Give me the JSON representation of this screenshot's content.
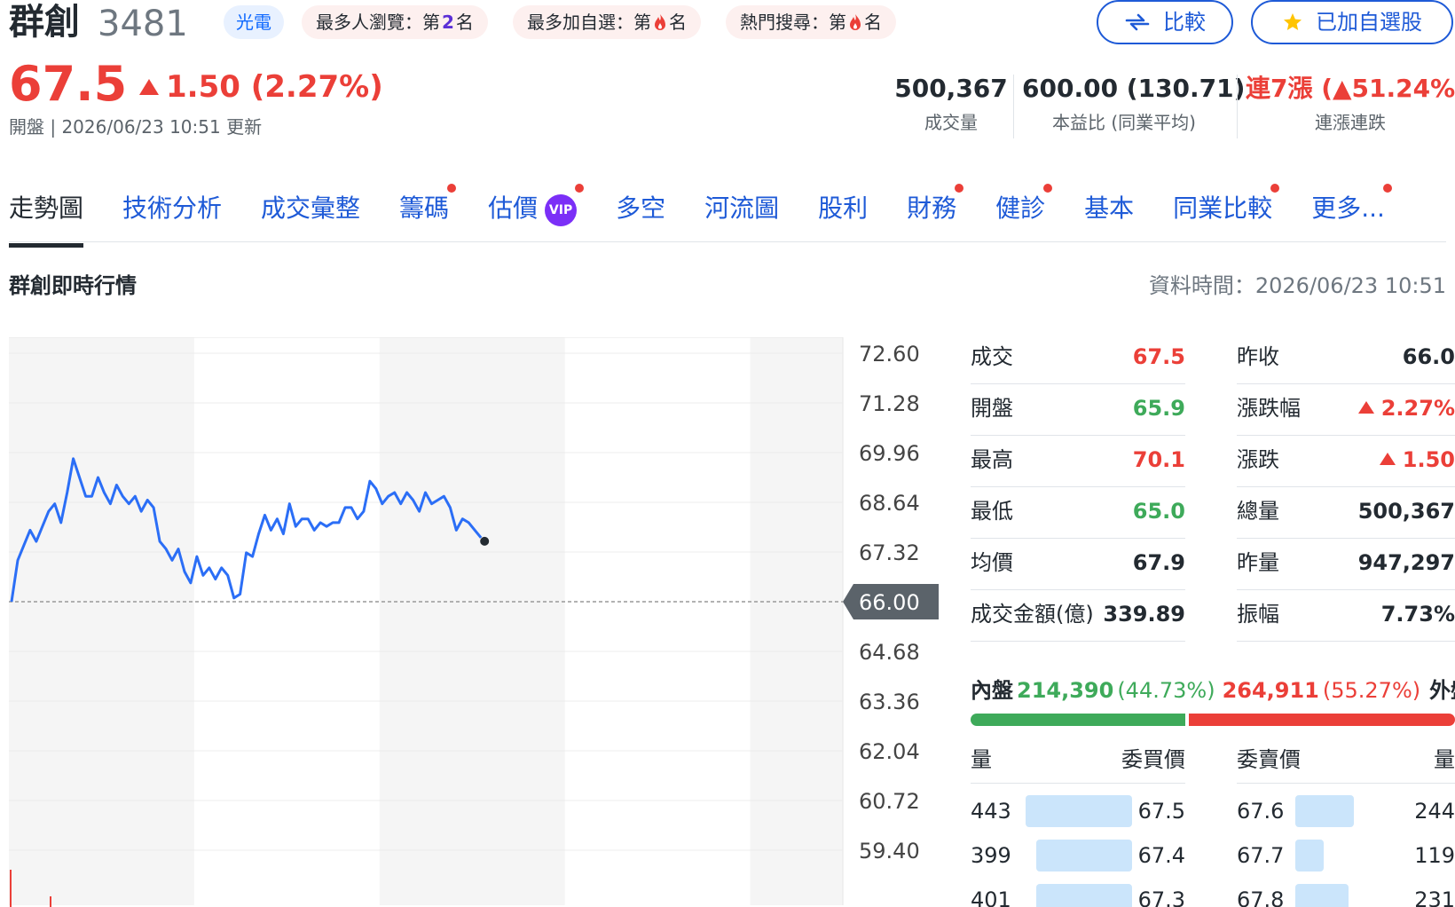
{
  "header": {
    "name": "群創",
    "code": "3481",
    "sector": "光電",
    "ranks": [
      {
        "prefix": "最多人瀏覽：第",
        "num": "2",
        "suffix": "名",
        "flame": false
      },
      {
        "prefix": "最多加自選：第",
        "num": "",
        "suffix": "名",
        "flame": true
      },
      {
        "prefix": "熱門搜尋：第",
        "num": "",
        "suffix": "名",
        "flame": true
      }
    ],
    "compare_label": "比較",
    "watchlist_label": "已加自選股"
  },
  "price": {
    "last": "67.5",
    "change": "1.50 (2.27%)",
    "status_line": "開盤 | 2026/06/23 10:51 更新"
  },
  "stats": [
    {
      "value": "500,367",
      "label": "成交量",
      "color": "#232a31"
    },
    {
      "value": "600.00 (130.71)",
      "label": "本益比 (同業平均)",
      "color": "#232a31"
    },
    {
      "value": "連7漲 (▲51.24%)",
      "label": "連漲連跌",
      "color": "#eb3f38"
    }
  ],
  "tabs": [
    {
      "label": "走勢圖",
      "active": true,
      "dot": false,
      "vip": false
    },
    {
      "label": "技術分析",
      "active": false,
      "dot": false,
      "vip": false
    },
    {
      "label": "成交彙整",
      "active": false,
      "dot": false,
      "vip": false
    },
    {
      "label": "籌碼",
      "active": false,
      "dot": true,
      "vip": false
    },
    {
      "label": "估價",
      "active": false,
      "dot": true,
      "vip": true
    },
    {
      "label": "多空",
      "active": false,
      "dot": false,
      "vip": false
    },
    {
      "label": "河流圖",
      "active": false,
      "dot": false,
      "vip": false
    },
    {
      "label": "股利",
      "active": false,
      "dot": false,
      "vip": false
    },
    {
      "label": "財務",
      "active": false,
      "dot": true,
      "vip": false
    },
    {
      "label": "健診",
      "active": false,
      "dot": true,
      "vip": false
    },
    {
      "label": "基本",
      "active": false,
      "dot": false,
      "vip": false
    },
    {
      "label": "同業比較",
      "active": false,
      "dot": true,
      "vip": false
    },
    {
      "label": "更多...",
      "active": false,
      "dot": true,
      "vip": false
    }
  ],
  "vip_label": "VIP",
  "section": {
    "title": "群創即時行情",
    "data_time": "資料時間：2026/06/23 10:51"
  },
  "colors": {
    "up": "#eb3f38",
    "down": "#3eaa5a",
    "line": "#2b6ef6",
    "link": "#1e5ad7"
  },
  "chart_data": {
    "type": "line",
    "y_ticks": [
      "72.60",
      "71.28",
      "69.96",
      "68.64",
      "67.32",
      "66.00",
      "64.68",
      "63.36",
      "62.04",
      "60.72",
      "59.40"
    ],
    "ylim": [
      59.4,
      72.6
    ],
    "reference_price": "66.00",
    "x_range_minutes": [
      0,
      270
    ],
    "series": [
      {
        "values": [
          66.0,
          67.1,
          67.5,
          67.9,
          67.6,
          68.0,
          68.4,
          68.6,
          68.1,
          68.9,
          69.8,
          69.3,
          68.8,
          68.8,
          69.3,
          68.9,
          68.6,
          69.1,
          68.8,
          68.6,
          68.8,
          68.4,
          68.7,
          68.5,
          67.6,
          67.4,
          67.1,
          67.4,
          66.8,
          66.5,
          67.2,
          66.7,
          66.9,
          66.6,
          66.9,
          66.7,
          66.1,
          66.2,
          67.3,
          67.2,
          67.8,
          68.3,
          67.9,
          68.2,
          67.8,
          68.6,
          68.0,
          68.2,
          68.2,
          67.9,
          68.1,
          68.0,
          68.1,
          68.1,
          68.5,
          68.5,
          68.2,
          68.4,
          69.2,
          69.0,
          68.6,
          68.8,
          68.9,
          68.6,
          68.9,
          68.7,
          68.4,
          68.9,
          68.6,
          68.7,
          68.8,
          68.5,
          67.9,
          68.2,
          68.1,
          67.9,
          67.7
        ],
        "x": [
          0,
          2,
          4,
          6,
          8,
          10,
          12,
          14,
          16,
          18,
          20,
          22,
          24,
          26,
          28,
          30,
          32,
          34,
          36,
          38,
          40,
          42,
          44,
          46,
          48,
          50,
          52,
          54,
          56,
          58,
          60,
          62,
          64,
          66,
          68,
          70,
          72,
          74,
          76,
          78,
          80,
          82,
          84,
          86,
          88,
          90,
          92,
          94,
          96,
          98,
          100,
          102,
          104,
          106,
          108,
          110,
          112,
          114,
          116,
          118,
          120,
          122,
          124,
          126,
          128,
          130,
          132,
          134,
          136,
          138,
          140,
          142,
          144,
          146,
          148,
          150,
          152
        ]
      }
    ]
  },
  "quote": {
    "left": [
      {
        "label": "成交",
        "value": "67.5",
        "color": "red"
      },
      {
        "label": "開盤",
        "value": "65.9",
        "color": "green"
      },
      {
        "label": "最高",
        "value": "70.1",
        "color": "red"
      },
      {
        "label": "最低",
        "value": "65.0",
        "color": "green"
      },
      {
        "label": "均價",
        "value": "67.9",
        "color": ""
      },
      {
        "label": "成交金額(億)",
        "value": "339.89",
        "color": ""
      }
    ],
    "right": [
      {
        "label": "昨收",
        "value": "66.0",
        "color": "",
        "arrow": false
      },
      {
        "label": "漲跌幅",
        "value": "2.27%",
        "color": "red",
        "arrow": true
      },
      {
        "label": "漲跌",
        "value": "1.50",
        "color": "red",
        "arrow": true
      },
      {
        "label": "總量",
        "value": "500,367",
        "color": "",
        "arrow": false
      },
      {
        "label": "昨量",
        "value": "947,297",
        "color": "",
        "arrow": false
      },
      {
        "label": "振幅",
        "value": "7.73%",
        "color": "",
        "arrow": false
      }
    ]
  },
  "inout": {
    "inner_label": "內盤",
    "inner_value": "214,390",
    "inner_pct": "(44.73%)",
    "outer_value": "264,911",
    "outer_pct": "(55.27%)",
    "outer_label": "外盤",
    "inner_share": 0.4473
  },
  "orderbook": {
    "headers": {
      "qty_left": "量",
      "bid": "委買價",
      "ask": "委賣價",
      "qty_right": "量"
    },
    "bids": [
      {
        "qty": "443",
        "price": "67.5",
        "fill": 1.0
      },
      {
        "qty": "399",
        "price": "67.4",
        "fill": 0.9
      },
      {
        "qty": "401",
        "price": "67.3",
        "fill": 0.9
      }
    ],
    "asks": [
      {
        "price": "67.6",
        "qty": "244",
        "fill": 0.55
      },
      {
        "price": "67.7",
        "qty": "119",
        "fill": 0.27
      },
      {
        "price": "67.8",
        "qty": "231",
        "fill": 0.5
      }
    ]
  }
}
